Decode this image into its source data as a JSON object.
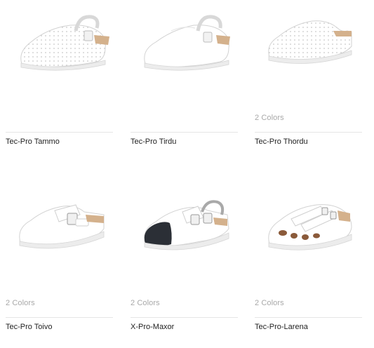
{
  "products": [
    {
      "name": "Tec-Pro Tammo",
      "colors": "",
      "image_icon": "perforated-clog-strap-icon"
    },
    {
      "name": "Tec-Pro Tirdu",
      "colors": "",
      "image_icon": "smooth-clog-strap-icon"
    },
    {
      "name": "Tec-Pro Thordu",
      "colors": "2 Colors",
      "image_icon": "perforated-slip-clog-icon"
    },
    {
      "name": "Tec-Pro Toivo",
      "colors": "2 Colors",
      "image_icon": "buckle-clog-icon"
    },
    {
      "name": "X-Pro-Maxor",
      "colors": "2 Colors",
      "image_icon": "safety-toe-clog-icon"
    },
    {
      "name": "Tec-Pro-Larena",
      "colors": "2 Colors",
      "image_icon": "cutout-sandal-icon"
    }
  ],
  "colors": {
    "shoe_white": "#ffffff",
    "shoe_shadow": "#dcdcdc",
    "cork": "#c9a27a",
    "toe_cap": "#2b2f36",
    "muted_text": "#a8a8a8",
    "text": "#1f1f1f"
  }
}
